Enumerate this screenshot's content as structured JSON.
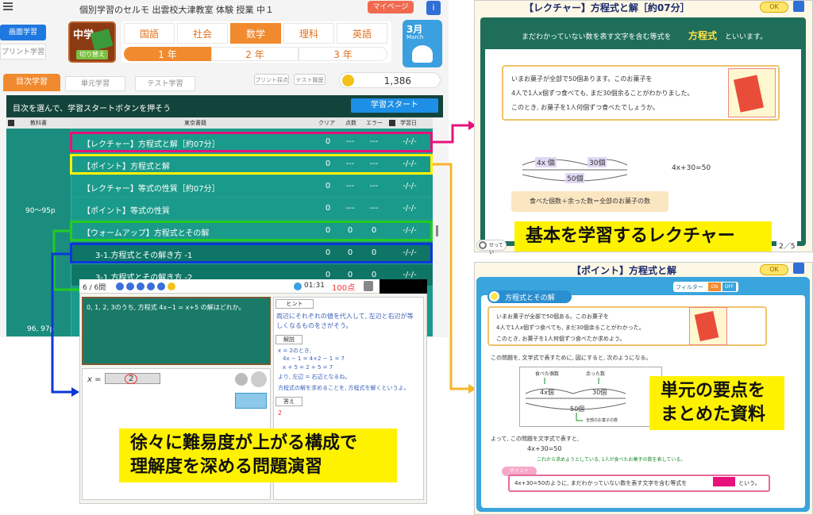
{
  "header": {
    "menu_icon": "hamburger-icon",
    "title": "個別学習のセルモ 出雲校大津教室 体験 授業 中１",
    "mypage": "マイページ"
  },
  "left_nav": {
    "screen": "画面学習",
    "print": "プリント学習"
  },
  "grade_badge": {
    "level": "中学",
    "change": "切り替え"
  },
  "subjects": [
    "国語",
    "社会",
    "数学",
    "理科",
    "英語"
  ],
  "years": [
    "1 年",
    "2 年",
    "3 年"
  ],
  "month": {
    "value": "3月",
    "label": "March"
  },
  "subtabs": {
    "toc": "目次学習",
    "unit": "単元学習",
    "test": "テスト学習",
    "print_grade": "プリント採点",
    "test_history": "テスト履歴"
  },
  "coins": "1,386",
  "instruction": "目次を選んで、学習スタートボタンを押そう",
  "start_button": "学習スタート",
  "table": {
    "headers": [
      "教科書",
      "東京書籍",
      "クリア",
      "点数",
      "エラー",
      "学習日"
    ],
    "range1": "90〜95p",
    "range2": "96, 97p",
    "rows": [
      {
        "title": "【レクチャー】方程式と解［約07分］",
        "clear": "0",
        "score": "---",
        "error": "---",
        "date": "-/-/-"
      },
      {
        "title": "【ポイント】方程式と解",
        "clear": "0",
        "score": "---",
        "error": "---",
        "date": "-/-/-"
      },
      {
        "title": "【レクチャー】等式の性質［約07分］",
        "clear": "0",
        "score": "---",
        "error": "---",
        "date": "-/-/-"
      },
      {
        "title": "【ポイント】等式の性質",
        "clear": "0",
        "score": "---",
        "error": "---",
        "date": "-/-/-"
      },
      {
        "title": "【ウォームアップ】方程式とその解",
        "clear": "0",
        "score": "0",
        "error": "0",
        "date": "-/-/-"
      },
      {
        "title": "3-1.方程式とその解き方 -1",
        "clear": "0",
        "score": "0",
        "error": "0",
        "date": "-/-/-"
      },
      {
        "title": "3-1.方程式とその解き方 -2",
        "clear": "0",
        "score": "0",
        "error": "0",
        "date": "-/-/-"
      }
    ]
  },
  "exercise": {
    "counter": "6 / 6問",
    "timer": "01:31",
    "score": "100点",
    "question": "0, 1, 2, 3のうち, 方程式 4x−1 = x+5 の解はどれか。",
    "answer_prefix": "x =",
    "answer_value": "2",
    "hint_label": "ヒント",
    "hint_text": "両辺にそれぞれの値を代入して, 左辺と右辺が等しくなるものをさがそう。",
    "explain_label": "解説",
    "explain_lines": [
      "x = 2のとき,",
      "4x − 1 = 4×2 − 1 = 7",
      "x + 5 = 2 + 5 = 7",
      "より, 左辺 = 右辺となるね。",
      "方程式の解を求めることを, 方程式を解くというよ。"
    ],
    "answer_label": "答え",
    "answer_text": "2"
  },
  "lecture": {
    "title": "【レクチャー】方程式と解［約07分］",
    "ok": "OK",
    "banner_pre": "まだわかっていない数を表す文字を含む等式を",
    "banner_key": "方程式",
    "banner_post": "といいます。",
    "problem": [
      "いまお菓子が全部で50個あります。このお菓子を",
      "4人で1人x個ずつ食べても, まだ30個余ることがわかりました。",
      "このとき, お菓子を1人何個ずつ食べたでしょうか。"
    ],
    "seg1": "4x 個",
    "seg2": "30個",
    "total": "50個",
    "equation": "4x+30=50",
    "summary": "食べた個数＋余った数＝全部のお菓子の数",
    "settings": "せってい",
    "page": "2／5"
  },
  "point": {
    "title": "【ポイント】方程式と解",
    "ok": "OK",
    "filter_label": "フィルター",
    "filter_on": "ON",
    "filter_off": "OFF",
    "section": "方程式とその解",
    "problem": [
      "いまお菓子が全部で50個ある。このお菓子を",
      "4人で1人x個ずつ食べても, まだ30個余ることがわかった。",
      "このとき, お菓子を1人何個ずつ食べたか求めよう。"
    ],
    "diagram_intro": "この問題を, 文字式で表すために, 図にすると, 次のようになる。",
    "eaten": "食べた個数",
    "rest": "余った数",
    "seg1": "4x個",
    "seg2": "30個",
    "total": "50個",
    "total_label": "全部のお菓子の数",
    "formula_intro": "よって, この問題を文字式で表すと,",
    "equation": "4x+30=50",
    "formula_note": "これから求めようとしている, 1人が食べたお菓子の数を表している。",
    "point_label": "ポイント",
    "point_pre": "4x+30=50のように, まだわかっていない数を表す文字を含む等式を",
    "point_post": "という。"
  },
  "callouts": {
    "lecture": "基本を学習するレクチャー",
    "point": [
      "単元の要点を",
      "まとめた資料"
    ],
    "exercise": [
      "徐々に難易度が上がる構成で",
      "理解度を深める問題演習"
    ]
  },
  "colors": {
    "orange": "#f18a2e",
    "teal": "#1a9a8a",
    "green_dark": "#0f6b5a",
    "magenta": "#e6127a",
    "yellow": "#fff200",
    "blue": "#0a37d8",
    "lime": "#22cc22"
  }
}
